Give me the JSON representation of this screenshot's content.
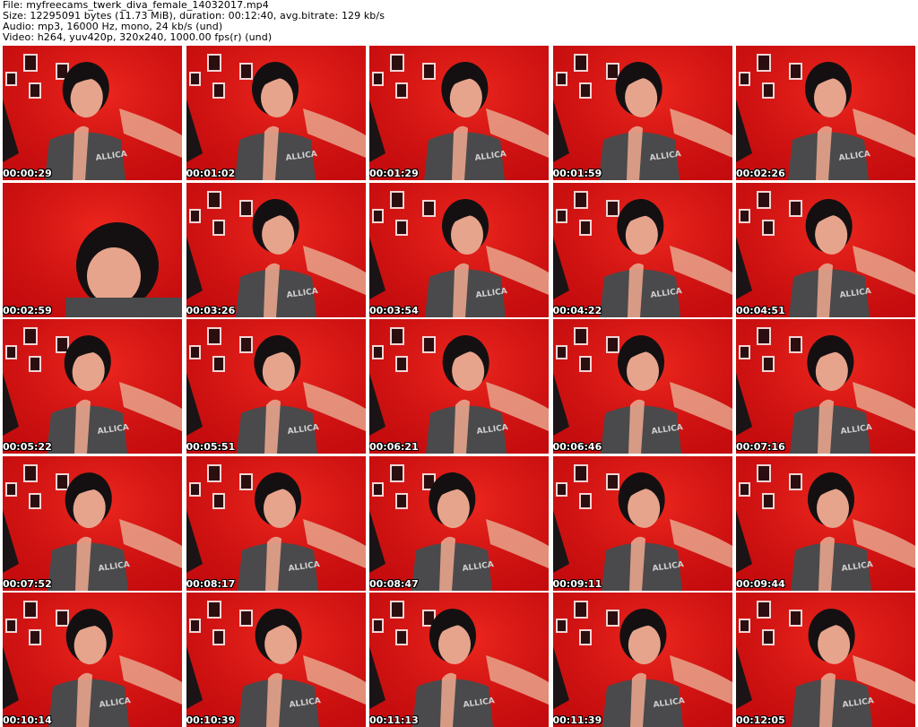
{
  "header": {
    "file_line": "File: myfreecams_twerk_diva_female_14032017.mp4",
    "size_line": "Size: 12295091 bytes (11.73 MiB), duration: 00:12:40, avg.bitrate: 129 kb/s",
    "audio_line": "Audio: mp3, 16000 Hz, mono, 24 kb/s (und)",
    "video_line": "Video: h264, yuv420p, 320x240, 1000.00 fps(r) (und)"
  },
  "frames": [
    {
      "timestamp": "00:00:29"
    },
    {
      "timestamp": "00:01:02"
    },
    {
      "timestamp": "00:01:29"
    },
    {
      "timestamp": "00:01:59"
    },
    {
      "timestamp": "00:02:26"
    },
    {
      "timestamp": "00:02:59"
    },
    {
      "timestamp": "00:03:26"
    },
    {
      "timestamp": "00:03:54"
    },
    {
      "timestamp": "00:04:22"
    },
    {
      "timestamp": "00:04:51"
    },
    {
      "timestamp": "00:05:22"
    },
    {
      "timestamp": "00:05:51"
    },
    {
      "timestamp": "00:06:21"
    },
    {
      "timestamp": "00:06:46"
    },
    {
      "timestamp": "00:07:16"
    },
    {
      "timestamp": "00:07:52"
    },
    {
      "timestamp": "00:08:17"
    },
    {
      "timestamp": "00:08:47"
    },
    {
      "timestamp": "00:09:11"
    },
    {
      "timestamp": "00:09:44"
    },
    {
      "timestamp": "00:10:14"
    },
    {
      "timestamp": "00:10:39"
    },
    {
      "timestamp": "00:11:13"
    },
    {
      "timestamp": "00:11:39"
    },
    {
      "timestamp": "00:12:05"
    }
  ],
  "colors": {
    "background_red": "#d80f0f",
    "shirt_gray": "#4a4a4c",
    "hair_black": "#141012",
    "skin": "#e7a48c"
  }
}
